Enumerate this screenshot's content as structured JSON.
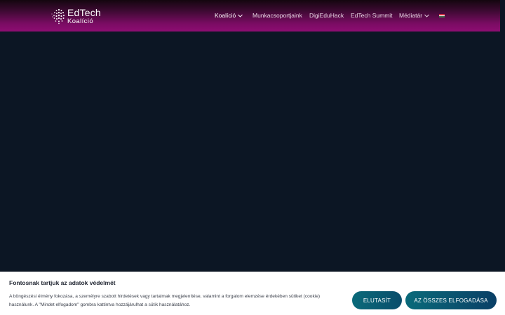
{
  "header": {
    "logo": {
      "line1": "EdTech",
      "line2": "Koalíció",
      "icon": "globe-dots-icon"
    },
    "nav": [
      {
        "label": "Koalíció",
        "has_dropdown": true,
        "active": true
      },
      {
        "label": "Munkacsoportjaink",
        "has_dropdown": false
      },
      {
        "label": "DigiEduHack",
        "has_dropdown": false
      },
      {
        "label": "EdTech Summit",
        "has_dropdown": false
      },
      {
        "label": "Médiatár",
        "has_dropdown": true
      },
      {
        "label": "",
        "icon": "hungarian-flag-icon"
      }
    ],
    "colors": {
      "gradient_top": "#14060f",
      "gradient_bottom": "#8e0d72"
    }
  },
  "main": {
    "background": "#0c1624"
  },
  "cookie_banner": {
    "title": "Fontosnak tartjuk az adatok védelmét",
    "text": "A böngészési élmény fokozása, a személyre szabott hirdetések vagy tartalmak megjelenítése, valamint a forgalom elemzése érdekében sütiket (cookie) használunk. A \"Mindet elfogadom\" gombra kattintva hozzájárulhat a sütik használatához.",
    "reject_label": "ELUTASÍT",
    "accept_label": "AZ ÖSSZES ELFOGADÁSA",
    "button_color": "#0a5a72"
  }
}
